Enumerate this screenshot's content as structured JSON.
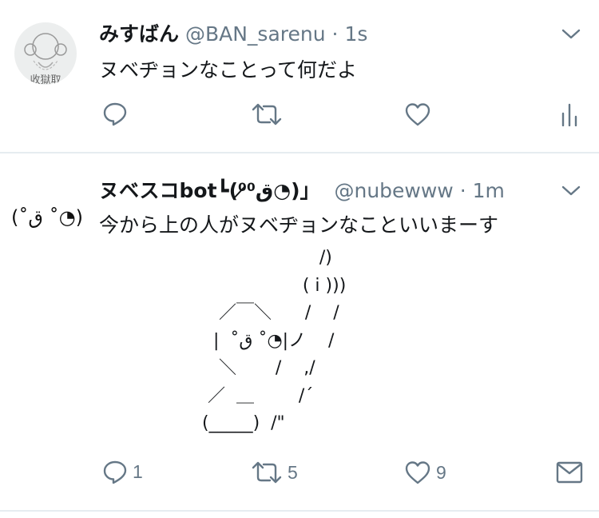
{
  "tweets": [
    {
      "name": "みすばん",
      "handle": "@BAN_sarenu",
      "separator": "·",
      "time": "1s",
      "text": "ヌベヂョンなことって何だよ",
      "actions": {
        "reply_count": "",
        "retweet_count": "",
        "like_count": ""
      },
      "avatar": {
        "kind": "drawn-character",
        "caption": "收獄取"
      }
    },
    {
      "name": "ヌベスコbot┗(⁰̷ق⁰̷◔)」",
      "handle": "@nubewww",
      "separator": "·",
      "time": "1m",
      "text": "今から上の人がヌベヂョンなこといいまーす",
      "avatar_text": "(˚ق ˚◔)",
      "ascii_art": [
        "                        /)",
        "                     ( i )))",
        "      ／￣＼      /    /",
        "     |  ˚ق ˚◔|ノ    /",
        "      ＼       /    ,/",
        "    ／  ＿        /´",
        "   (_____)  /\""
      ],
      "actions": {
        "reply_count": "1",
        "retweet_count": "5",
        "like_count": "9"
      }
    }
  ],
  "icons": [
    "reply-icon",
    "retweet-icon",
    "like-icon",
    "analytics-icon",
    "message-icon",
    "chevron-down-icon"
  ],
  "colors": {
    "icon_gray": "#657786",
    "text": "#14171a",
    "divider": "#e6ecf0"
  }
}
